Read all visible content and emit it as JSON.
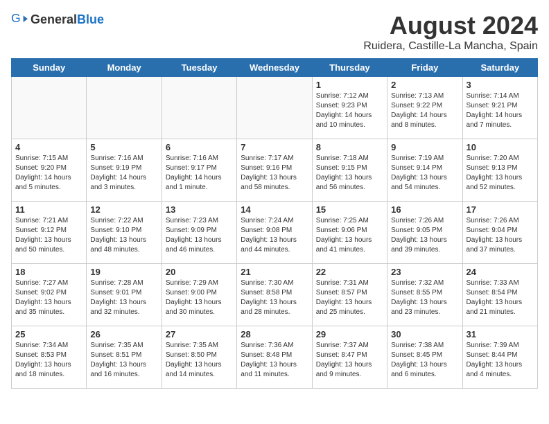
{
  "header": {
    "logo_general": "General",
    "logo_blue": "Blue",
    "title": "August 2024",
    "subtitle": "Ruidera, Castille-La Mancha, Spain"
  },
  "days_of_week": [
    "Sunday",
    "Monday",
    "Tuesday",
    "Wednesday",
    "Thursday",
    "Friday",
    "Saturday"
  ],
  "weeks": [
    [
      {
        "day": "",
        "info": "",
        "empty": true
      },
      {
        "day": "",
        "info": "",
        "empty": true
      },
      {
        "day": "",
        "info": "",
        "empty": true
      },
      {
        "day": "",
        "info": "",
        "empty": true
      },
      {
        "day": "1",
        "info": "Sunrise: 7:12 AM\nSunset: 9:23 PM\nDaylight: 14 hours\nand 10 minutes."
      },
      {
        "day": "2",
        "info": "Sunrise: 7:13 AM\nSunset: 9:22 PM\nDaylight: 14 hours\nand 8 minutes."
      },
      {
        "day": "3",
        "info": "Sunrise: 7:14 AM\nSunset: 9:21 PM\nDaylight: 14 hours\nand 7 minutes."
      }
    ],
    [
      {
        "day": "4",
        "info": "Sunrise: 7:15 AM\nSunset: 9:20 PM\nDaylight: 14 hours\nand 5 minutes."
      },
      {
        "day": "5",
        "info": "Sunrise: 7:16 AM\nSunset: 9:19 PM\nDaylight: 14 hours\nand 3 minutes."
      },
      {
        "day": "6",
        "info": "Sunrise: 7:16 AM\nSunset: 9:17 PM\nDaylight: 14 hours\nand 1 minute."
      },
      {
        "day": "7",
        "info": "Sunrise: 7:17 AM\nSunset: 9:16 PM\nDaylight: 13 hours\nand 58 minutes."
      },
      {
        "day": "8",
        "info": "Sunrise: 7:18 AM\nSunset: 9:15 PM\nDaylight: 13 hours\nand 56 minutes."
      },
      {
        "day": "9",
        "info": "Sunrise: 7:19 AM\nSunset: 9:14 PM\nDaylight: 13 hours\nand 54 minutes."
      },
      {
        "day": "10",
        "info": "Sunrise: 7:20 AM\nSunset: 9:13 PM\nDaylight: 13 hours\nand 52 minutes."
      }
    ],
    [
      {
        "day": "11",
        "info": "Sunrise: 7:21 AM\nSunset: 9:12 PM\nDaylight: 13 hours\nand 50 minutes."
      },
      {
        "day": "12",
        "info": "Sunrise: 7:22 AM\nSunset: 9:10 PM\nDaylight: 13 hours\nand 48 minutes."
      },
      {
        "day": "13",
        "info": "Sunrise: 7:23 AM\nSunset: 9:09 PM\nDaylight: 13 hours\nand 46 minutes."
      },
      {
        "day": "14",
        "info": "Sunrise: 7:24 AM\nSunset: 9:08 PM\nDaylight: 13 hours\nand 44 minutes."
      },
      {
        "day": "15",
        "info": "Sunrise: 7:25 AM\nSunset: 9:06 PM\nDaylight: 13 hours\nand 41 minutes."
      },
      {
        "day": "16",
        "info": "Sunrise: 7:26 AM\nSunset: 9:05 PM\nDaylight: 13 hours\nand 39 minutes."
      },
      {
        "day": "17",
        "info": "Sunrise: 7:26 AM\nSunset: 9:04 PM\nDaylight: 13 hours\nand 37 minutes."
      }
    ],
    [
      {
        "day": "18",
        "info": "Sunrise: 7:27 AM\nSunset: 9:02 PM\nDaylight: 13 hours\nand 35 minutes."
      },
      {
        "day": "19",
        "info": "Sunrise: 7:28 AM\nSunset: 9:01 PM\nDaylight: 13 hours\nand 32 minutes."
      },
      {
        "day": "20",
        "info": "Sunrise: 7:29 AM\nSunset: 9:00 PM\nDaylight: 13 hours\nand 30 minutes."
      },
      {
        "day": "21",
        "info": "Sunrise: 7:30 AM\nSunset: 8:58 PM\nDaylight: 13 hours\nand 28 minutes."
      },
      {
        "day": "22",
        "info": "Sunrise: 7:31 AM\nSunset: 8:57 PM\nDaylight: 13 hours\nand 25 minutes."
      },
      {
        "day": "23",
        "info": "Sunrise: 7:32 AM\nSunset: 8:55 PM\nDaylight: 13 hours\nand 23 minutes."
      },
      {
        "day": "24",
        "info": "Sunrise: 7:33 AM\nSunset: 8:54 PM\nDaylight: 13 hours\nand 21 minutes."
      }
    ],
    [
      {
        "day": "25",
        "info": "Sunrise: 7:34 AM\nSunset: 8:53 PM\nDaylight: 13 hours\nand 18 minutes."
      },
      {
        "day": "26",
        "info": "Sunrise: 7:35 AM\nSunset: 8:51 PM\nDaylight: 13 hours\nand 16 minutes."
      },
      {
        "day": "27",
        "info": "Sunrise: 7:35 AM\nSunset: 8:50 PM\nDaylight: 13 hours\nand 14 minutes."
      },
      {
        "day": "28",
        "info": "Sunrise: 7:36 AM\nSunset: 8:48 PM\nDaylight: 13 hours\nand 11 minutes."
      },
      {
        "day": "29",
        "info": "Sunrise: 7:37 AM\nSunset: 8:47 PM\nDaylight: 13 hours\nand 9 minutes."
      },
      {
        "day": "30",
        "info": "Sunrise: 7:38 AM\nSunset: 8:45 PM\nDaylight: 13 hours\nand 6 minutes."
      },
      {
        "day": "31",
        "info": "Sunrise: 7:39 AM\nSunset: 8:44 PM\nDaylight: 13 hours\nand 4 minutes."
      }
    ]
  ]
}
